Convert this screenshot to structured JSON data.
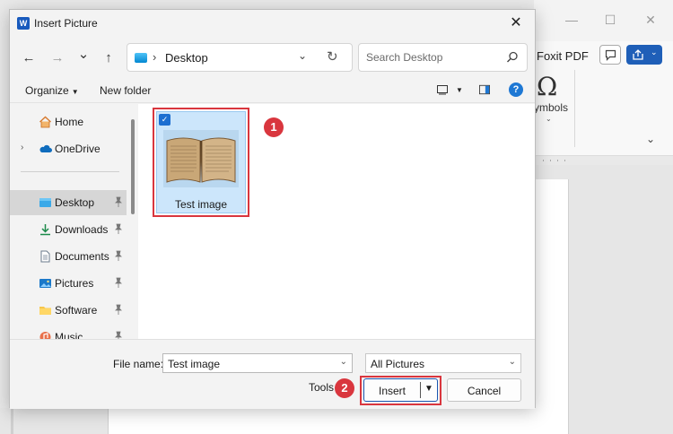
{
  "background_word": {
    "foxit_tab": "Foxit PDF",
    "symbols_label": "ymbols",
    "omega_glyph": "Ω",
    "share_color": "#1f5fb8"
  },
  "dialog": {
    "title": "Insert Picture",
    "app_icon_letter": "W",
    "close_glyph": "✕"
  },
  "navigation": {
    "back_glyph": "←",
    "forward_glyph": "→",
    "recent_glyph": "⌄",
    "up_glyph": "↑",
    "address": {
      "separator": "›",
      "location": "Desktop"
    },
    "search": {
      "placeholder": "Search Desktop",
      "value": ""
    }
  },
  "commands": {
    "organize": "Organize",
    "new_folder": "New folder",
    "help_glyph": "?"
  },
  "sidebar": {
    "items": [
      {
        "label": "Home",
        "icon": "home-icon",
        "pinned": false,
        "expandable": false
      },
      {
        "label": "OneDrive",
        "icon": "cloud-icon",
        "pinned": false,
        "expandable": true
      },
      {
        "label": "Desktop",
        "icon": "desktop-icon",
        "pinned": true,
        "selected": true
      },
      {
        "label": "Downloads",
        "icon": "download-icon",
        "pinned": true
      },
      {
        "label": "Documents",
        "icon": "document-icon",
        "pinned": true
      },
      {
        "label": "Pictures",
        "icon": "pictures-icon",
        "pinned": true
      },
      {
        "label": "Software",
        "icon": "folder-icon",
        "pinned": true
      },
      {
        "label": "Music",
        "icon": "music-icon",
        "pinned": true
      }
    ]
  },
  "files": [
    {
      "name": "Test image",
      "selected": true,
      "thumbnail": "open-book-photo"
    }
  ],
  "annotations": {
    "step1": "1",
    "step2": "2",
    "highlight_color": "#d9363e"
  },
  "footer": {
    "file_name_label": "File name:",
    "file_name_value": "Test image",
    "file_type": "All Pictures",
    "tools_label": "Tools",
    "insert_label": "Insert",
    "cancel_label": "Cancel"
  }
}
